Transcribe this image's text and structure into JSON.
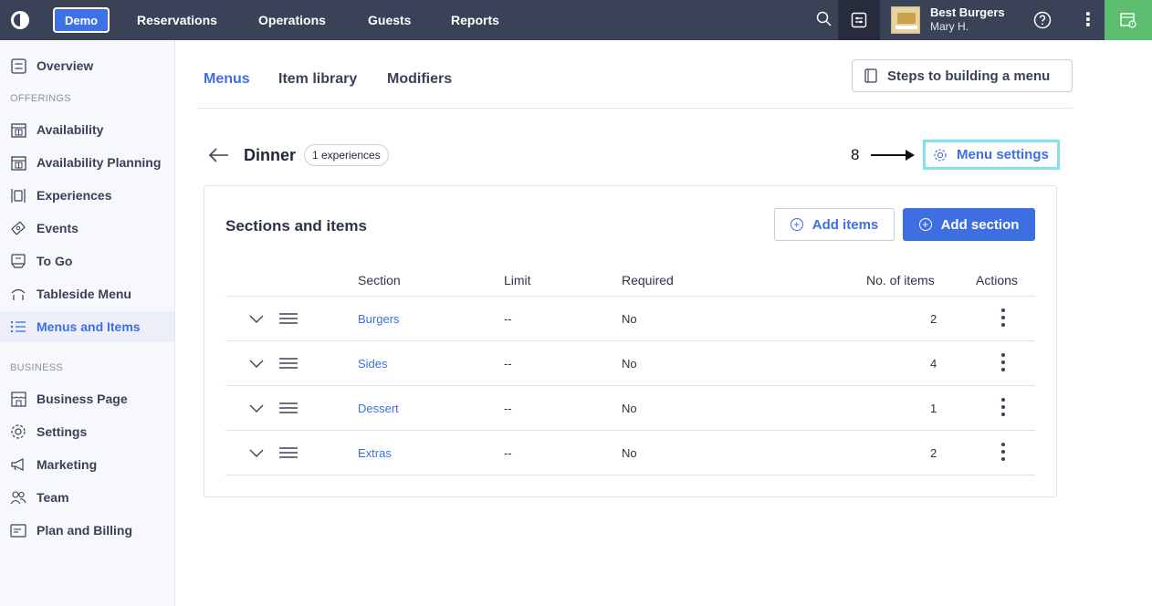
{
  "topbar": {
    "demo_label": "Demo",
    "nav": [
      "Reservations",
      "Operations",
      "Guests",
      "Reports"
    ],
    "business_name": "Best Burgers",
    "user_name": "Mary H.",
    "bg_color": "#3a4257",
    "accent_color": "#3e6ee2",
    "calendar_color": "#5cbd6e"
  },
  "sidebar": {
    "overview": "Overview",
    "offerings_heading": "OFFERINGS",
    "offerings": [
      {
        "label": "Availability",
        "icon": "calendar-grid-icon"
      },
      {
        "label": "Availability Planning",
        "icon": "calendar-grid-icon"
      },
      {
        "label": "Experiences",
        "icon": "utensils-plate-icon"
      },
      {
        "label": "Events",
        "icon": "ticket-icon"
      },
      {
        "label": "To Go",
        "icon": "takeout-bag-icon"
      },
      {
        "label": "Tableside Menu",
        "icon": "wifi-signal-icon"
      },
      {
        "label": "Menus and Items",
        "icon": "list-icon",
        "active": true
      }
    ],
    "business_heading": "BUSINESS",
    "business": [
      {
        "label": "Business Page",
        "icon": "storefront-icon"
      },
      {
        "label": "Settings",
        "icon": "gear-icon"
      },
      {
        "label": "Marketing",
        "icon": "megaphone-icon"
      },
      {
        "label": "Team",
        "icon": "people-icon"
      },
      {
        "label": "Plan and Billing",
        "icon": "billing-card-icon"
      }
    ]
  },
  "tabs": [
    "Menus",
    "Item library",
    "Modifiers"
  ],
  "steps_button": "Steps to building a menu",
  "menu": {
    "title": "Dinner",
    "badge": "1 experiences",
    "annotation": "8",
    "settings_label": "Menu settings"
  },
  "card": {
    "title": "Sections and items",
    "add_items": "Add items",
    "add_section": "Add section",
    "columns": [
      "Section",
      "Limit",
      "Required",
      "No. of items",
      "Actions"
    ],
    "rows": [
      {
        "section": "Burgers",
        "limit": "--",
        "required": "No",
        "count": "2"
      },
      {
        "section": "Sides",
        "limit": "--",
        "required": "No",
        "count": "4"
      },
      {
        "section": "Dessert",
        "limit": "--",
        "required": "No",
        "count": "1"
      },
      {
        "section": "Extras",
        "limit": "--",
        "required": "No",
        "count": "2"
      }
    ]
  }
}
